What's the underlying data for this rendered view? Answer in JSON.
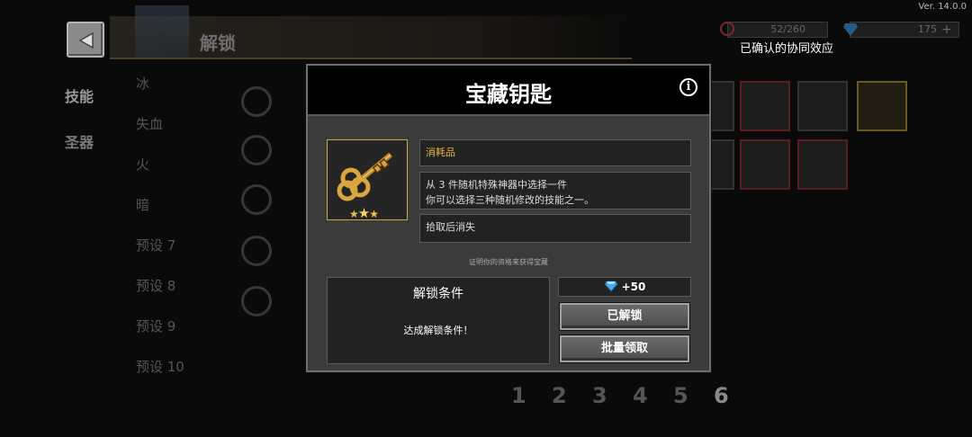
{
  "version": "Ver. 14.0.0",
  "header": {
    "title": "解锁"
  },
  "sidebar": {
    "tabs": [
      {
        "label": "技能"
      },
      {
        "label": "圣器"
      }
    ]
  },
  "list": {
    "items": [
      {
        "label": "冰"
      },
      {
        "label": "失血"
      },
      {
        "label": "火"
      },
      {
        "label": "暗"
      },
      {
        "label": "预设 7"
      },
      {
        "label": "预设 8"
      },
      {
        "label": "预设 9"
      },
      {
        "label": "预设 10"
      }
    ]
  },
  "resources": {
    "count": "52/260",
    "gems": "175",
    "synergy": "已确认的协同效应"
  },
  "pages": [
    "1",
    "2",
    "3",
    "4",
    "5",
    "6"
  ],
  "modal": {
    "title": "宝藏钥匙",
    "info_icon": "i",
    "category": "消耗品",
    "description_line1": "从 3 件随机特殊神器中选择一件",
    "description_line2": "你可以选择三种随机修改的技能之一。",
    "note": "拾取后消失",
    "proof": "证明你的资格来获得宝藏",
    "unlock_condition_title": "解锁条件",
    "unlock_condition_text": "达成解锁条件！",
    "reward": "+50",
    "button_unlocked": "已解锁",
    "button_claim_all": "批量领取"
  },
  "colors": {
    "accent_gold": "#e8b545",
    "gem_blue": "#4aa8f0",
    "modal_bg": "#3b3b3b"
  },
  "icons": [
    "back-arrow-icon",
    "info-icon",
    "gem-icon",
    "golden-key-icon",
    "star-icon",
    "forbidden-icon",
    "lock-icon"
  ]
}
